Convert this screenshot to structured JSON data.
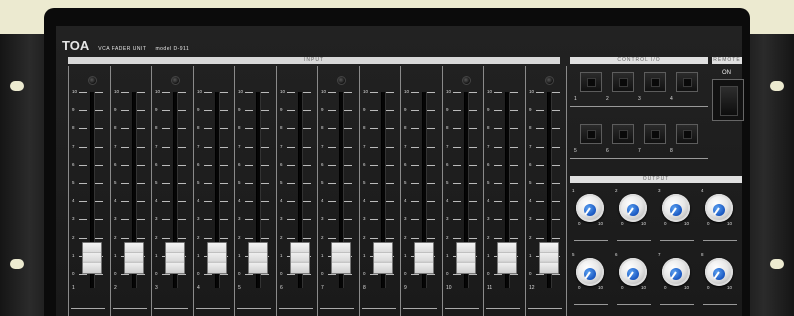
{
  "brand": {
    "logo": "TOA",
    "unit_name": "VCA FADER UNIT",
    "model": "model D-911"
  },
  "sections": {
    "input": "INPUT",
    "control_io": "CONTROL I/O",
    "remote": "REMOTE",
    "remote_on": "ON",
    "output": "OUTPUT"
  },
  "fader_scale": [
    "10",
    "9",
    "8",
    "7",
    "6",
    "5",
    "4",
    "3",
    "2",
    "1",
    "0"
  ],
  "input_channels": [
    {
      "num": "1",
      "led": true
    },
    {
      "num": "2",
      "led": false
    },
    {
      "num": "3",
      "led": true
    },
    {
      "num": "4",
      "led": false
    },
    {
      "num": "5",
      "led": false
    },
    {
      "num": "6",
      "led": false
    },
    {
      "num": "7",
      "led": true
    },
    {
      "num": "8",
      "led": false
    },
    {
      "num": "9",
      "led": false
    },
    {
      "num": "10",
      "led": true
    },
    {
      "num": "11",
      "led": false
    },
    {
      "num": "12",
      "led": true
    }
  ],
  "control_switches_row1": [
    "1",
    "2",
    "3",
    "4"
  ],
  "control_switches_row2": [
    "5",
    "6",
    "7",
    "8"
  ],
  "output_dials_row1": [
    {
      "num": "1",
      "min": "0",
      "max": "10"
    },
    {
      "num": "2",
      "min": "0",
      "max": "10"
    },
    {
      "num": "3",
      "min": "0",
      "max": "10"
    },
    {
      "num": "4",
      "min": "0",
      "max": "10"
    }
  ],
  "output_dials_row2": [
    {
      "num": "5",
      "min": "0",
      "max": "10"
    },
    {
      "num": "6",
      "min": "0",
      "max": "10"
    },
    {
      "num": "7",
      "min": "0",
      "max": "10"
    },
    {
      "num": "8",
      "min": "0",
      "max": "10"
    }
  ],
  "colors": {
    "background": "#ecead0",
    "panel": "#1c1c1c",
    "knob_cap": "#1a58c2"
  }
}
